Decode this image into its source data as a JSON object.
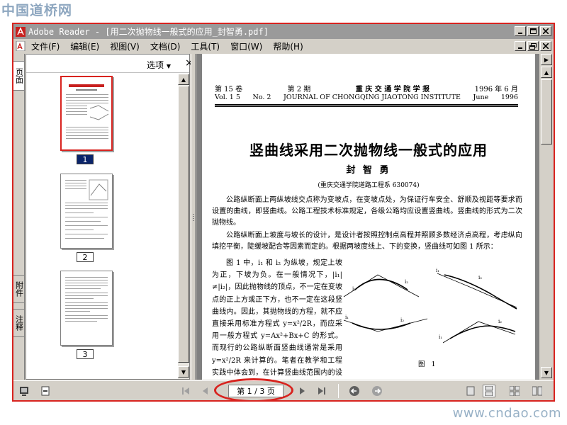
{
  "watermark": {
    "top": "中国道桥网",
    "bottom": "www.cndao.com"
  },
  "window": {
    "title": "Adobe Reader - [用二次抛物线一般式的应用_封智勇.pdf]"
  },
  "menu": {
    "items": [
      "文件(F)",
      "编辑(E)",
      "视图(V)",
      "文档(D)",
      "工具(T)",
      "窗口(W)",
      "帮助(H)"
    ]
  },
  "side_tabs": {
    "pages": "页面",
    "attachments": "附件",
    "comments": "注释"
  },
  "thumbnails": {
    "options_label": "选项",
    "close_glyph": "×",
    "labels": [
      "1",
      "2",
      "3"
    ]
  },
  "document": {
    "header_cn": {
      "volume": "第 15 卷",
      "issue": "第 2 期",
      "journal": "重 庆 交 通 学 院 学 报",
      "date": "1996 年 6 月"
    },
    "header_en": {
      "volume": "Vol. 1 5",
      "issue": "No. 2",
      "journal": "JOURNAL OF CHONGQING JIAOTONG INSTITUTE",
      "month": "June",
      "year": "1996"
    },
    "title": "竖曲线采用二次抛物线一般式的应用",
    "author": "封 智 勇",
    "affiliation": "(重庆交通学院道路工程系 630074)",
    "paragraph1": "公路纵断面上两纵坡线交点称为变坡点，在变坡点处，为保证行车安全、舒顺及视距等要求而设置的曲线，即竖曲线。公路工程技术标准规定，各级公路均应设置竖曲线。竖曲线的形式为二次抛物线。",
    "paragraph2": "公路纵断面上坡度与坡长的设计，是设计者按照控制点高程并照顾多数经济点高程，考虑纵向填挖平衡，陡缓坡配合等因素而定的。根据两坡度线上、下的变换，竖曲线可如图 1 所示：",
    "paragraph3": "图 1 中，i₁ 和 i₂ 为纵坡，规定上坡为正，下坡为负。在一般情况下，|i₁|≠|i₂|，因此抛物线的顶点，不一定在变坡点的正上方或正下方，也不一定在这段竖曲线内。因此，其抛物线的方程，就不应直接采用标准方程式 y=x²/2R，而应采用一般方程式 y=Ax²+Bx+C 的形式。而现行的公路纵断面竖曲线通常是采用 y=x²/2R 来计算的。笔者在教学和工程实践中体会到，在计算竖曲线范围内的设计标高",
    "figure_caption": "图 1",
    "figure_labels": [
      "i₁",
      "i₂",
      "i₁",
      "i₂",
      "i₁",
      "i₂",
      "i₁",
      "i₂"
    ]
  },
  "statusbar": {
    "page_display": "第 1 / 3 页"
  }
}
